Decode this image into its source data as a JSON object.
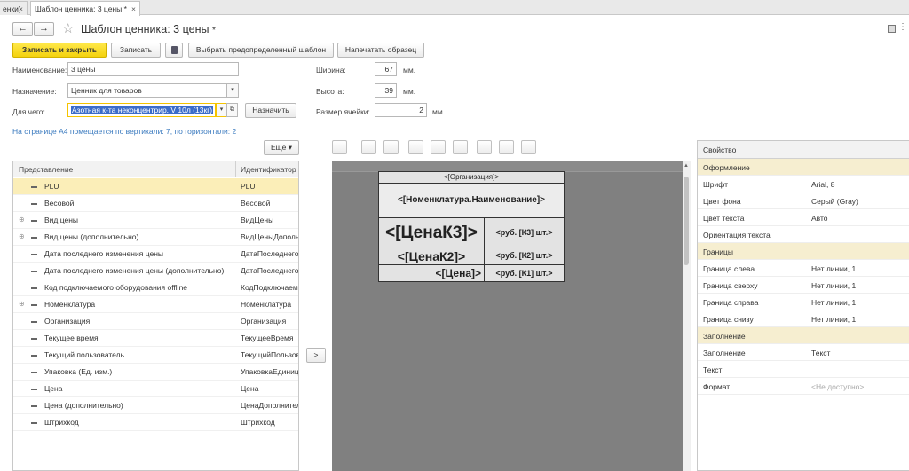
{
  "tabs": [
    {
      "label": "енки)"
    },
    {
      "label": "Шаблон ценника: 3 цены *"
    }
  ],
  "title": "Шаблон ценника: 3 цены",
  "title_mark": "*",
  "toolbar": {
    "save_close": "Записать и закрыть",
    "save": "Записать",
    "predefined": "Выбрать предопределенный шаблон",
    "print_sample": "Напечатать образец"
  },
  "form": {
    "name_label": "Наименование:",
    "name_value": "3 цены",
    "purpose_label": "Назначение:",
    "purpose_value": "Ценник для товаров",
    "for_label": "Для чего:",
    "for_value": "Азотная к-та неконцентрир. V 10л (13кг)",
    "assign_button": "Назначить",
    "width_label": "Ширина:",
    "width_value": "67",
    "width_unit": "мм.",
    "height_label": "Высота:",
    "height_value": "39",
    "height_unit": "мм.",
    "cell_label": "Размер ячейки:",
    "cell_value": "2",
    "cell_unit": "мм."
  },
  "info_text": "На странице А4 помещается по вертикали: 7, по горизонтали: 2",
  "more_button": "Еще",
  "move_button": ">",
  "tree": {
    "col_view": "Представление",
    "col_id": "Идентификатор",
    "rows": [
      {
        "view": "PLU",
        "id": "PLU",
        "expand": "",
        "highlight": true
      },
      {
        "view": "Весовой",
        "id": "Весовой",
        "expand": ""
      },
      {
        "view": "Вид цены",
        "id": "ВидЦены",
        "expand": "⊕"
      },
      {
        "view": "Вид цены (дополнительно)",
        "id": "ВидЦеныДополни",
        "expand": "⊕"
      },
      {
        "view": "Дата последнего изменения цены",
        "id": "ДатаПоследнего",
        "expand": ""
      },
      {
        "view": "Дата последнего изменения цены (дополнительно)",
        "id": "ДатаПоследнего",
        "expand": ""
      },
      {
        "view": "Код подключаемого оборудования offline",
        "id": "КодПодключаем",
        "expand": ""
      },
      {
        "view": "Номенклатура",
        "id": "Номенклатура",
        "expand": "⊕"
      },
      {
        "view": "Организация",
        "id": "Организация",
        "expand": ""
      },
      {
        "view": "Текущее время",
        "id": "ТекущееВремя",
        "expand": ""
      },
      {
        "view": "Текущий пользователь",
        "id": "ТекущийПользов",
        "expand": ""
      },
      {
        "view": "Упаковка (Ед. изм.)",
        "id": "УпаковкаЕдиница",
        "expand": ""
      },
      {
        "view": "Цена",
        "id": "Цена",
        "expand": ""
      },
      {
        "view": "Цена (дополнительно)",
        "id": "ЦенаДополнител",
        "expand": ""
      },
      {
        "view": "Штрихкод",
        "id": "Штрихкод",
        "expand": ""
      }
    ]
  },
  "template": {
    "org": "<[Организация]>",
    "nomen": "<[Номенклатура.Наименование]>",
    "price3": "<[ЦенаК3]>",
    "price3_unit": "<руб. [К3] шт.>",
    "price2": "<[ЦенаК2]>",
    "price2_unit": "<руб. [К2] шт.>",
    "price1": "<[Цена]>",
    "price1_unit": "<руб. [К1] шт.>"
  },
  "properties": {
    "header": "Свойство",
    "rows": [
      {
        "key": "Оформление",
        "value": "",
        "group": true
      },
      {
        "key": "Шрифт",
        "value": "Arial, 8"
      },
      {
        "key": "Цвет фона",
        "value": "Серый (Gray)"
      },
      {
        "key": "Цвет текста",
        "value": "Авто"
      },
      {
        "key": "Ориентация текста",
        "value": ""
      },
      {
        "key": "Границы",
        "value": "",
        "group": true
      },
      {
        "key": "Граница слева",
        "value": "Нет линии, 1"
      },
      {
        "key": "Граница сверху",
        "value": "Нет линии, 1"
      },
      {
        "key": "Граница справа",
        "value": "Нет линии, 1"
      },
      {
        "key": "Граница снизу",
        "value": "Нет линии, 1"
      },
      {
        "key": "Заполнение",
        "value": "",
        "group": true
      },
      {
        "key": "Заполнение",
        "value": "Текст"
      },
      {
        "key": "Текст",
        "value": ""
      },
      {
        "key": "Формат",
        "value": "<Не доступно>",
        "na": true
      }
    ]
  },
  "colors": {
    "accent": "#f4d20e",
    "selection": "#fbeeb8",
    "group": "#f6eed0",
    "canvas": "#808080"
  }
}
